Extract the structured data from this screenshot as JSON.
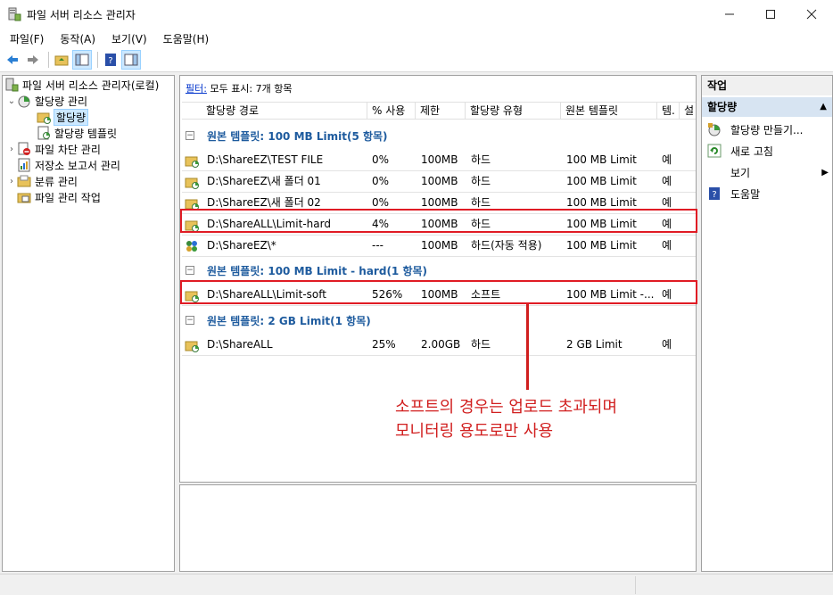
{
  "window": {
    "title": "파일 서버 리소스 관리자"
  },
  "menu": [
    "파일(F)",
    "동작(A)",
    "보기(V)",
    "도움말(H)"
  ],
  "tree": [
    {
      "label": "파일 서버 리소스 관리자(로컬)",
      "icon": "server-icon",
      "expander": ""
    },
    {
      "label": "할당량 관리",
      "icon": "quota-management-icon",
      "expander": "⌄"
    },
    {
      "label": "할당량",
      "icon": "quota-folder-icon",
      "expander": "",
      "selected": true
    },
    {
      "label": "할당량 템플릿",
      "icon": "quota-template-icon",
      "expander": ""
    },
    {
      "label": "파일 차단 관리",
      "icon": "file-screen-icon",
      "expander": "›"
    },
    {
      "label": "저장소 보고서 관리",
      "icon": "report-icon",
      "expander": ""
    },
    {
      "label": "분류 관리",
      "icon": "classification-icon",
      "expander": "›"
    },
    {
      "label": "파일 관리 작업",
      "icon": "file-task-icon",
      "expander": ""
    }
  ],
  "filter": {
    "link": "필터:",
    "text": "모두 표시: 7개 항목"
  },
  "columns": [
    "할당량 경로",
    "% 사용",
    "제한",
    "할당량 유형",
    "원본 템플릿",
    "템.",
    "설"
  ],
  "groups": [
    {
      "title": "원본 템플릿: 100 MB Limit(5 항목)",
      "rows": [
        {
          "path": "D:\\ShareEZ\\TEST FILE",
          "used": "0%",
          "limit": "100MB",
          "type": "하드",
          "template": "100 MB Limit",
          "match": "예"
        },
        {
          "path": "D:\\ShareEZ\\새 폴더 01",
          "used": "0%",
          "limit": "100MB",
          "type": "하드",
          "template": "100 MB Limit",
          "match": "예"
        },
        {
          "path": "D:\\ShareEZ\\새 폴더 02",
          "used": "0%",
          "limit": "100MB",
          "type": "하드",
          "template": "100 MB Limit",
          "match": "예"
        },
        {
          "path": "D:\\ShareALL\\Limit-hard",
          "used": "4%",
          "limit": "100MB",
          "type": "하드",
          "template": "100 MB Limit",
          "match": "예"
        },
        {
          "path": "D:\\ShareEZ\\*",
          "used": "---",
          "limit": "100MB",
          "type": "하드(자동 적용)",
          "template": "100 MB Limit",
          "match": "예"
        }
      ]
    },
    {
      "title": "원본 템플릿: 100 MB Limit - hard(1 항목)",
      "rows": [
        {
          "path": "D:\\ShareALL\\Limit-soft",
          "used": "526%",
          "limit": "100MB",
          "type": "소프트",
          "template": "100 MB Limit -...",
          "match": "예"
        }
      ]
    },
    {
      "title": "원본 템플릿: 2 GB Limit(1 항목)",
      "rows": [
        {
          "path": "D:\\ShareALL",
          "used": "25%",
          "limit": "2.00GB",
          "type": "하드",
          "template": "2 GB Limit",
          "match": "예"
        }
      ]
    }
  ],
  "annotation": [
    "소프트의 경우는 업로드 초과되며",
    "모니터링 용도로만 사용"
  ],
  "actions": {
    "header": "작업",
    "section": "할당량",
    "items": [
      {
        "label": "할당량 만들기...",
        "icon": "create-quota-icon"
      },
      {
        "label": "새로 고침",
        "icon": "refresh-icon"
      },
      {
        "label": "보기",
        "icon": "",
        "submenu": true
      },
      {
        "label": "도움말",
        "icon": "help-icon"
      }
    ]
  },
  "colors": {
    "highlight": "#e01b24",
    "annotation": "#d11f1f",
    "group_title": "#1e5b9e"
  }
}
